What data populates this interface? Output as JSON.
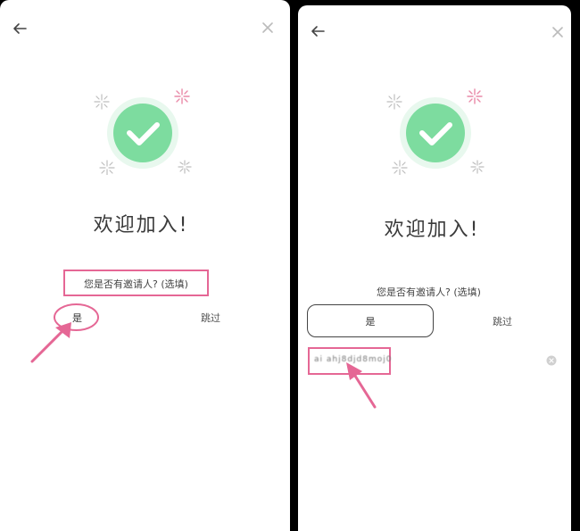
{
  "colors": {
    "accent": "#e56795",
    "check_green": "#7ddc9f",
    "check_glow": "#e8f8ee",
    "sparkle_pink": "#e98aa8",
    "sparkle_gray": "#bdbdbd"
  },
  "icons": {
    "back": "arrow-left-icon",
    "close": "close-icon",
    "success": "check-circle-icon",
    "clear": "clear-circle-icon"
  },
  "left_screen": {
    "title": "欢迎加入!",
    "question": "您是否有邀请人? (选填)",
    "yes_label": "是",
    "skip_label": "跳过"
  },
  "right_screen": {
    "title": "欢迎加入!",
    "question": "您是否有邀请人? (选填)",
    "yes_label": "是",
    "skip_label": "跳过",
    "invite_code_value": "ai ahj8djd8moj0"
  }
}
